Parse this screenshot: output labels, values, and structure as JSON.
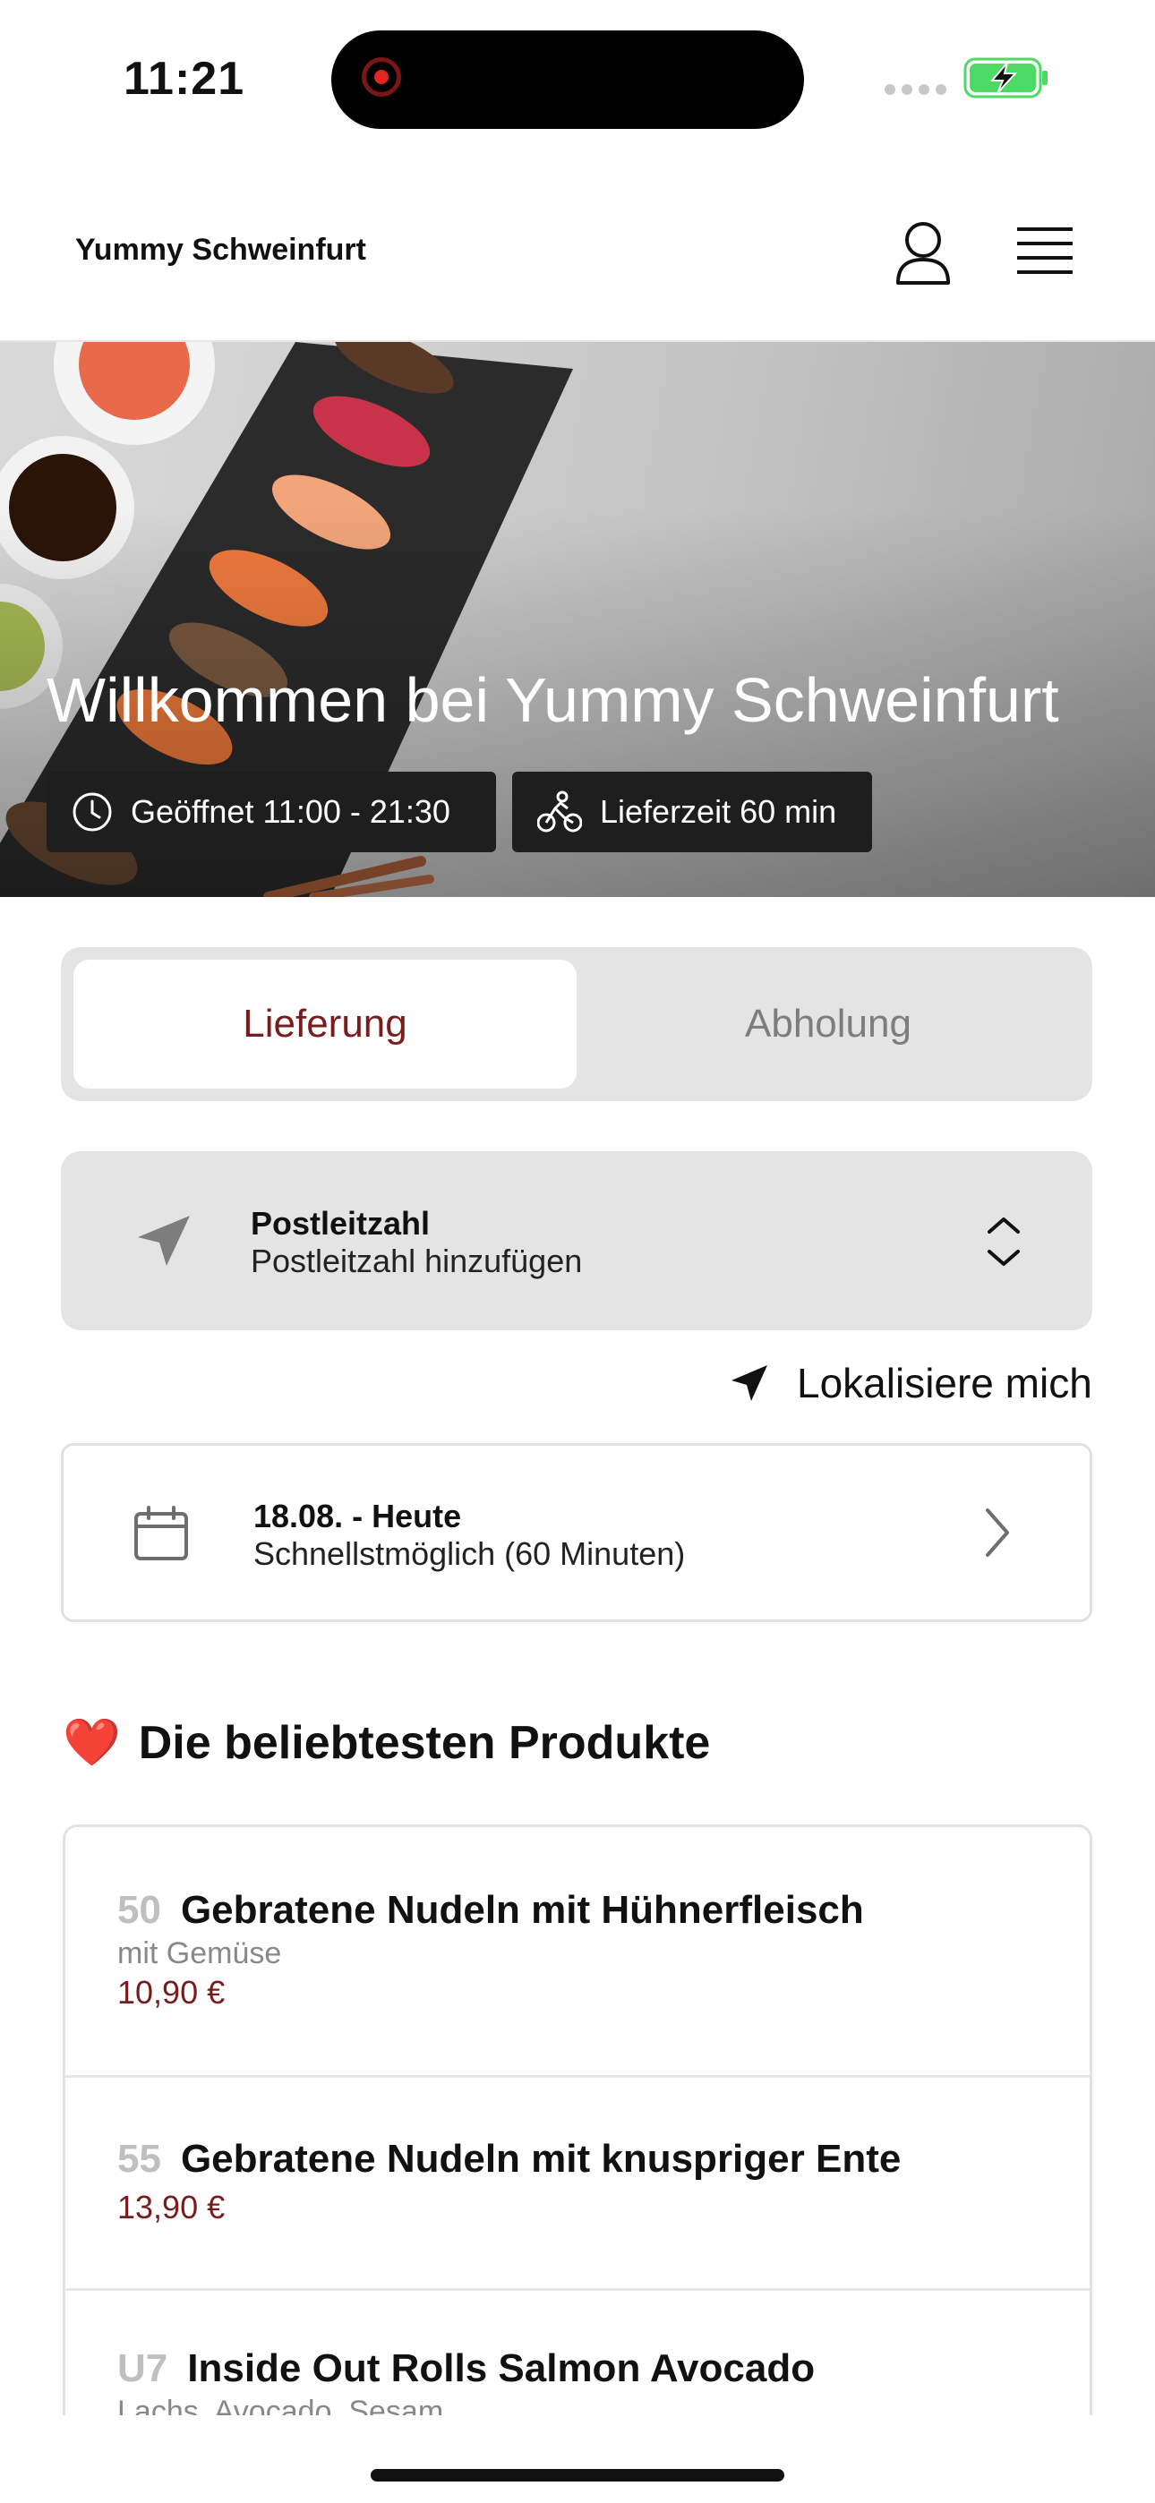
{
  "status_bar": {
    "time": "11:21"
  },
  "header": {
    "brand": "Yummy Schweinfurt",
    "user_icon": "user-icon",
    "menu_icon": "hamburger-menu-icon"
  },
  "hero": {
    "title": "Willkommen bei Yummy Schweinfurt",
    "opening_hours": "Geöffnet 11:00 - 21:30",
    "delivery_time": "Lieferzeit 60 min"
  },
  "order_mode": {
    "tabs": [
      {
        "label": "Lieferung",
        "selected": true
      },
      {
        "label": "Abholung",
        "selected": false
      }
    ]
  },
  "postal_code": {
    "title": "Postleitzahl",
    "subtitle": "Postleitzahl hinzufügen"
  },
  "locate": {
    "label": "Lokalisiere mich"
  },
  "delivery_date": {
    "title": "18.08. - Heute",
    "subtitle": "Schnellstmöglich (60 Minuten)"
  },
  "popular": {
    "emoji": "❤️",
    "heading": "Die beliebtesten Produkte",
    "products": [
      {
        "number": "50",
        "name": "Gebratene Nudeln mit Hühnerfleisch",
        "description": "mit Gemüse",
        "price": "10,90 €"
      },
      {
        "number": "55",
        "name": "Gebratene Nudeln mit knuspriger Ente",
        "description": "",
        "price": "13,90 €"
      },
      {
        "number": "U7",
        "name": "Inside Out Rolls Salmon Avocado",
        "description": "Lachs, Avocado, Sesam",
        "price": ""
      }
    ]
  },
  "colors": {
    "accent": "#7a1c1c",
    "chip_background": "#1e1e1e",
    "panel_background": "#e4e4e4",
    "battery_green": "#4cd964"
  }
}
